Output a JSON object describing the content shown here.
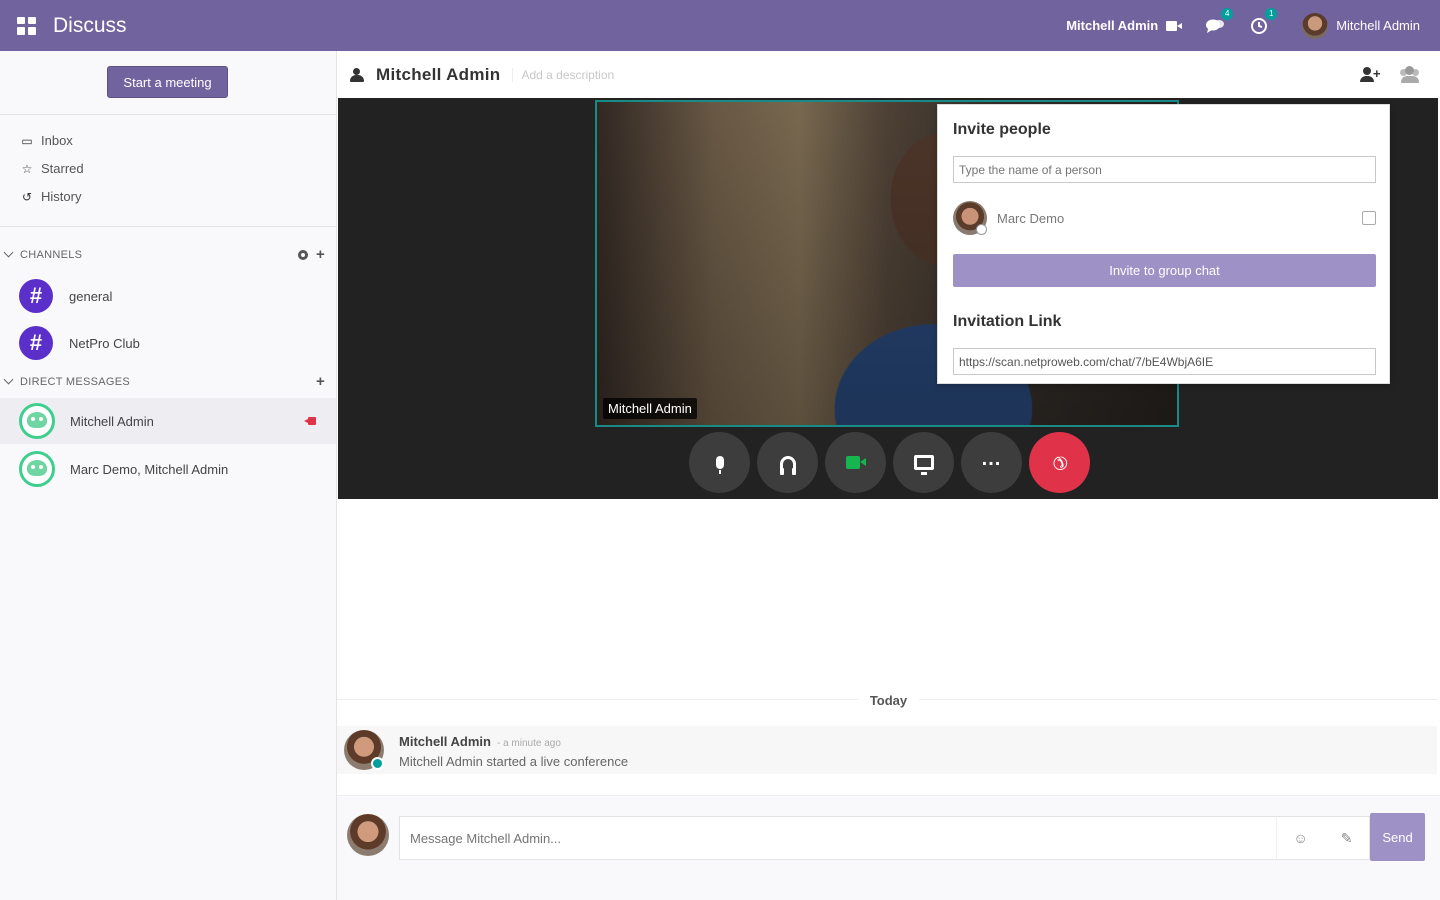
{
  "topbar": {
    "app_title": "Discuss",
    "call_user": "Mitchell Admin",
    "messages_badge": "4",
    "activities_badge": "1",
    "user_name": "Mitchell Admin"
  },
  "sidebar": {
    "start_meeting": "Start a meeting",
    "mailboxes": [
      {
        "label": "Inbox",
        "icon": "inbox-icon"
      },
      {
        "label": "Starred",
        "icon": "star-icon"
      },
      {
        "label": "History",
        "icon": "history-icon"
      }
    ],
    "channels_header": "CHANNELS",
    "channels": [
      {
        "label": "general",
        "icon": "#"
      },
      {
        "label": "NetPro Club",
        "icon": "#"
      }
    ],
    "dm_header": "DIRECT MESSAGES",
    "direct_messages": [
      {
        "label": "Mitchell Admin",
        "active": true
      },
      {
        "label": "Marc Demo, Mitchell Admin",
        "active": false
      }
    ]
  },
  "thread": {
    "title": "Mitchell Admin",
    "description_placeholder": "Add a description"
  },
  "call": {
    "tile_name": "Mitchell Admin",
    "hangup_color": "#e0334a",
    "camera_color": "#17b54f"
  },
  "invite": {
    "title": "Invite people",
    "search_placeholder": "Type the name of a person",
    "partner_name": "Marc Demo",
    "invite_button": "Invite to group chat",
    "link_title": "Invitation Link",
    "link_value": "https://scan.netproweb.com/chat/7/bE4WbjA6IE"
  },
  "messages": {
    "date_separator": "Today",
    "items": [
      {
        "author": "Mitchell Admin",
        "time": "- a minute ago",
        "text": "Mitchell Admin started a live conference"
      }
    ]
  },
  "composer": {
    "placeholder": "Message Mitchell Admin...",
    "send_label": "Send"
  },
  "colors": {
    "brand": "#71639e",
    "accent": "#00a09d"
  }
}
